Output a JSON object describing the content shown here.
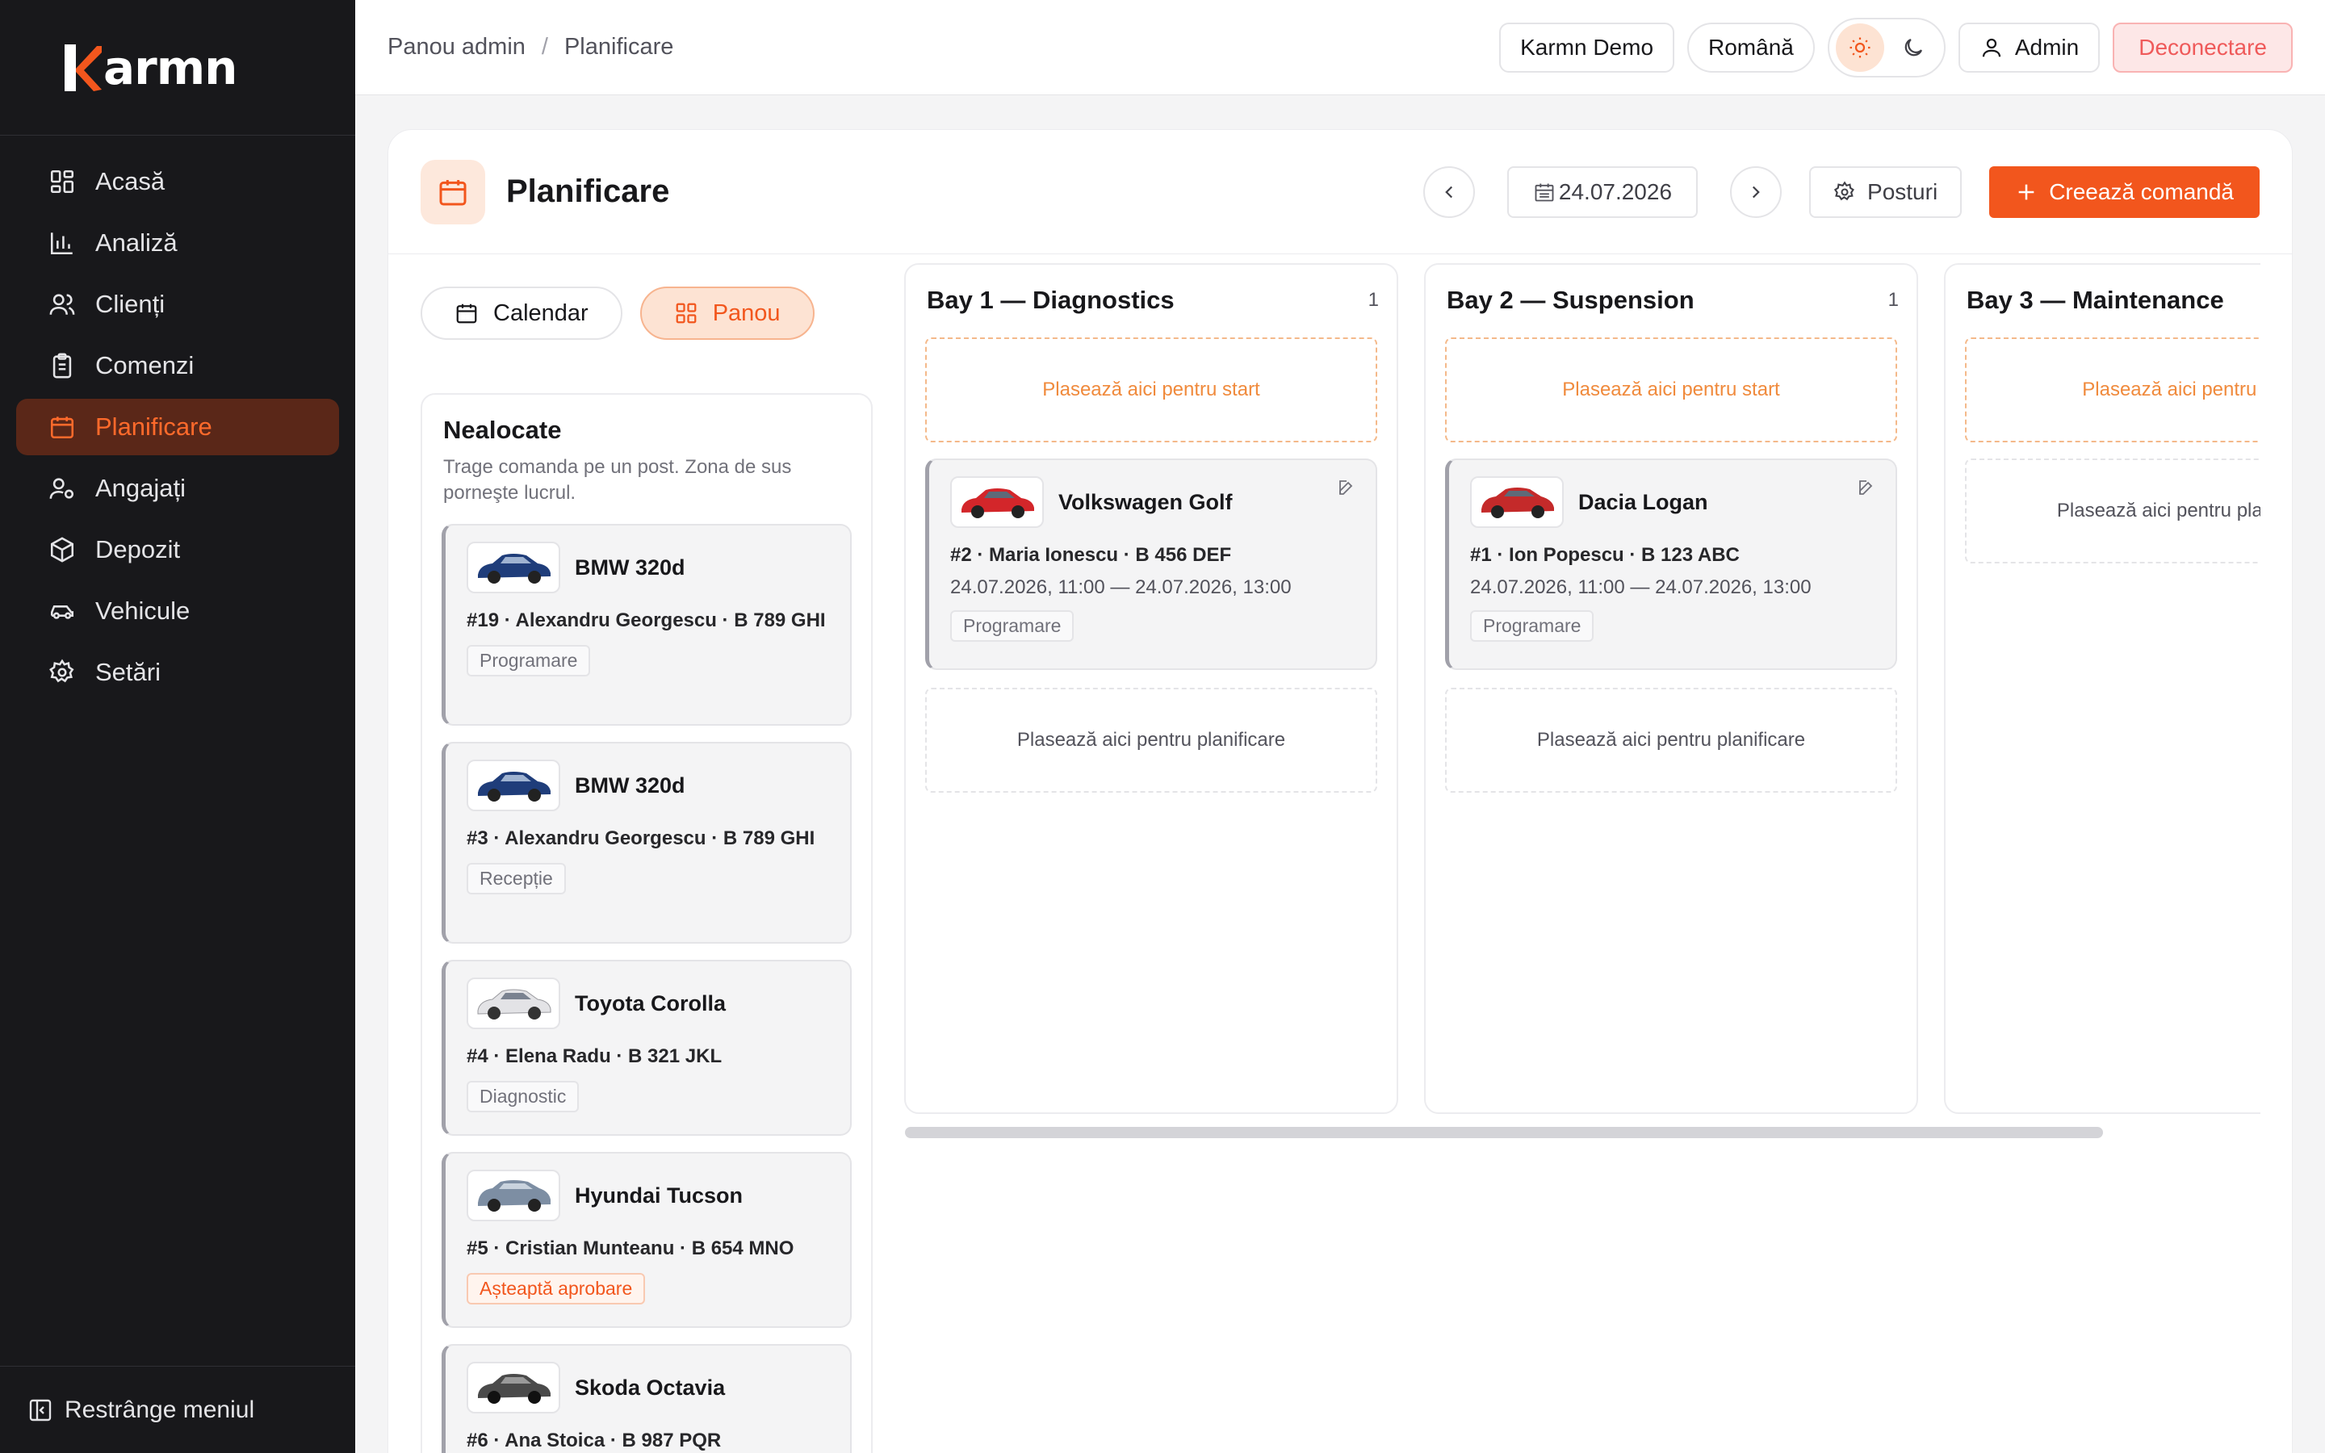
{
  "brand": {
    "name": "armn",
    "accent": "#f2561d"
  },
  "sidebar": {
    "items": [
      {
        "label": "Acasă",
        "icon": "dashboard-icon"
      },
      {
        "label": "Analiză",
        "icon": "chart-icon"
      },
      {
        "label": "Clienți",
        "icon": "users-icon"
      },
      {
        "label": "Comenzi",
        "icon": "clipboard-icon"
      },
      {
        "label": "Planificare",
        "icon": "calendar-icon",
        "active": true
      },
      {
        "label": "Angajați",
        "icon": "user-gear-icon"
      },
      {
        "label": "Depozit",
        "icon": "box-icon"
      },
      {
        "label": "Vehicule",
        "icon": "car-icon"
      },
      {
        "label": "Setări",
        "icon": "gear-icon"
      }
    ],
    "collapse_label": "Restrânge meniul"
  },
  "topbar": {
    "breadcrumb": [
      "Panou admin",
      "Planificare"
    ],
    "tenant": "Karmn Demo",
    "language": "Română",
    "user": "Admin",
    "logout": "Deconectare"
  },
  "page": {
    "title": "Planificare",
    "date": "24.07.2026",
    "bays_button": "Posturi",
    "create_button": "Creează comandă",
    "view_tabs": [
      "Calendar",
      "Panou"
    ],
    "active_view": "Panou"
  },
  "unassigned": {
    "title": "Nealocate",
    "hint": "Trage comanda pe un post. Zona de sus porneşte lucrul.",
    "jobs": [
      {
        "car": "BMW 320d",
        "meta": "#19 · Alexandru Georgescu · B 789 GHI",
        "status": "Programare",
        "color": "#1f3d7a"
      },
      {
        "car": "BMW 320d",
        "meta": "#3 · Alexandru Georgescu · B 789 GHI",
        "status": "Recepție",
        "color": "#1f3d7a"
      },
      {
        "car": "Toyota Corolla",
        "meta": "#4 · Elena Radu · B 321 JKL",
        "status": "Diagnostic",
        "color": "#e8e8ea"
      },
      {
        "car": "Hyundai Tucson",
        "meta": "#5 · Cristian Munteanu · B 654 MNO",
        "status": "Așteaptă aprobare",
        "warn": true,
        "color": "#7d8ea3"
      },
      {
        "car": "Skoda Octavia",
        "meta": "#6 · Ana Stoica · B 987 PQR",
        "status": "",
        "color": "#4a4a4a"
      }
    ]
  },
  "bays": [
    {
      "title": "Bay 1 — Diagnostics",
      "count": "1",
      "drop_start": "Plasează aici pentru start",
      "drop_plan": "Plasează aici pentru planificare",
      "job": {
        "car": "Volkswagen Golf",
        "meta": "#2 · Maria Ionescu · B 456 DEF",
        "time": "24.07.2026, 11:00 — 24.07.2026, 13:00",
        "status": "Programare",
        "color": "#d3262a"
      }
    },
    {
      "title": "Bay 2 — Suspension",
      "count": "1",
      "drop_start": "Plasează aici pentru start",
      "drop_plan": "Plasează aici pentru planificare",
      "job": {
        "car": "Dacia Logan",
        "meta": "#1 · Ion Popescu · B 123 ABC",
        "time": "24.07.2026, 11:00 — 24.07.2026, 13:00",
        "status": "Programare",
        "color": "#c42a2a"
      }
    },
    {
      "title": "Bay 3 — Maintenance",
      "count": "",
      "drop_start": "Plasează aici pentru start",
      "drop_plan": "Plasează aici pentru planificare"
    }
  ]
}
